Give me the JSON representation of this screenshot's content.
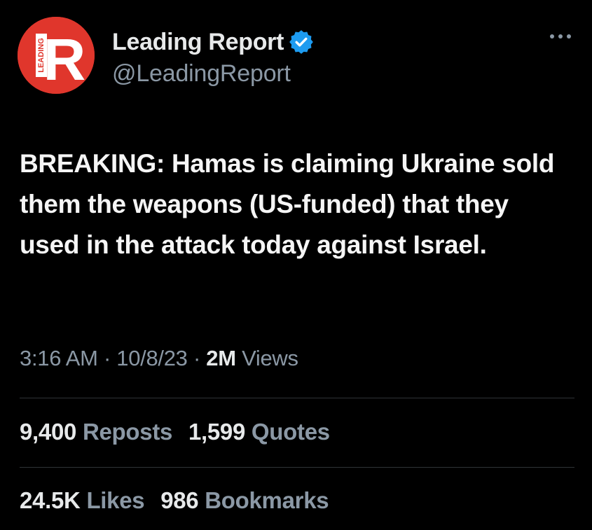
{
  "account": {
    "display_name": "Leading Report",
    "handle": "@LeadingReport",
    "avatar_letter": "R",
    "avatar_side_text": "LEADING",
    "avatar_color": "#e0362c",
    "verified_color": "#1d9bf0"
  },
  "tweet": {
    "text": "BREAKING: Hamas is claiming Ukraine sold them the weapons (US-funded) that they used in the attack today against Israel."
  },
  "meta": {
    "time": "3:16 AM",
    "separator": " · ",
    "date": "10/8/23",
    "views_count": "2M",
    "views_label": " Views"
  },
  "stats": {
    "reposts_count": "9,400",
    "reposts_label": "Reposts",
    "quotes_count": "1,599",
    "quotes_label": "Quotes",
    "likes_count": "24.5K",
    "likes_label": "Likes",
    "bookmarks_count": "986",
    "bookmarks_label": "Bookmarks"
  },
  "icons": {
    "more": "more-options-icon",
    "verified": "verified-badge-icon"
  }
}
